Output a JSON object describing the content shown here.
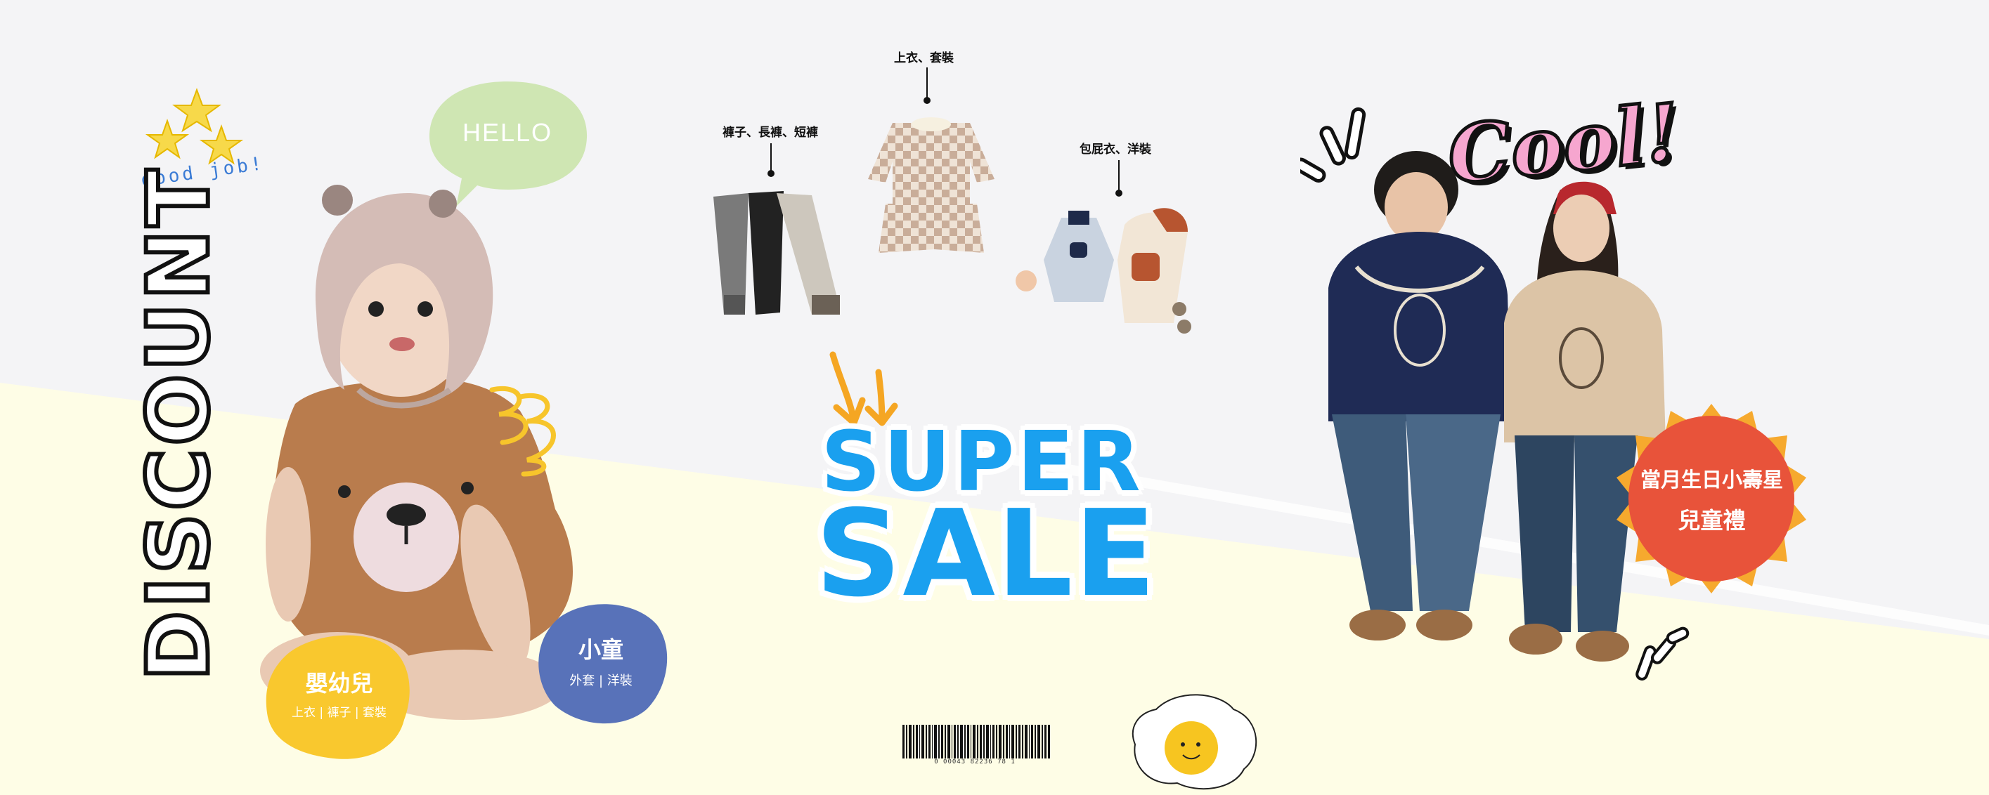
{
  "banner": {
    "discount_text": "DISCOUNT",
    "good_job_text": "good job!",
    "hello_text": "HELLO",
    "super_text": "SUPER",
    "sale_text": "SALE",
    "cool_text": "Cool!",
    "barcode_number": "0 00043 82236 78 1"
  },
  "product_labels": {
    "pants": "褲子、長褲、短褲",
    "tops": "上衣、套裝",
    "bodysuits": "包屁衣、洋裝"
  },
  "categories": {
    "baby": {
      "title": "嬰幼兒",
      "subtitle": "上衣 | 褲子 | 套裝"
    },
    "kids": {
      "title": "小童",
      "subtitle": "外套 | 洋裝"
    }
  },
  "birthday_badge": {
    "line1": "當月生日小壽星",
    "line2": "兒童禮"
  },
  "colors": {
    "sale_blue": "#1aa0ef",
    "cream": "#fefde6",
    "hello_green": "#cfe6b3",
    "yellow_blob": "#f9c82e",
    "blue_blob": "#5872b9",
    "orange_badge": "#e8533a",
    "cool_pink": "#f6a6cf"
  }
}
